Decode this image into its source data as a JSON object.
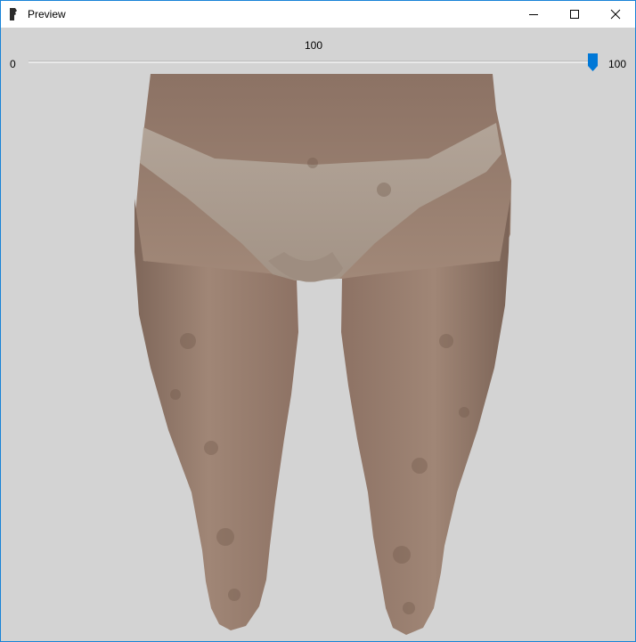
{
  "window": {
    "title": "Preview",
    "icons": {
      "app": "app-icon",
      "minimize": "minimize-icon",
      "maximize": "maximize-icon",
      "close": "close-icon"
    },
    "accent_color": "#1883d7"
  },
  "slider": {
    "current_value": "100",
    "min_label": "0",
    "max_label": "100",
    "value": 100,
    "min": 0,
    "max": 100,
    "thumb_color": "#0078d7"
  },
  "preview": {
    "background_color": "#d3d3d3",
    "skin_color": "#9d8070"
  }
}
